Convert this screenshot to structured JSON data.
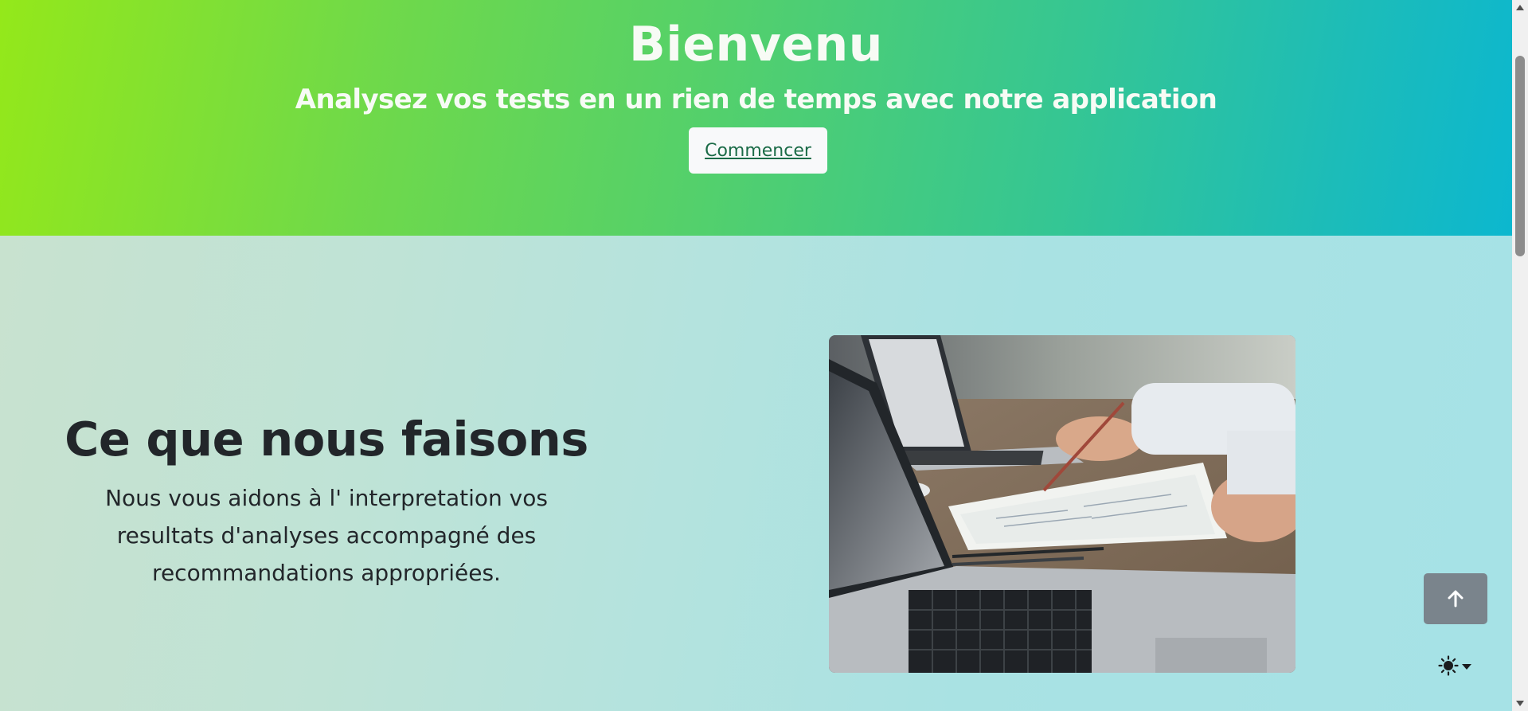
{
  "hero": {
    "title": "Bienvenu",
    "subtitle": "Analysez vos tests en un rien de temps avec notre application",
    "button_label": "Commencer"
  },
  "about": {
    "title": "Ce que nous faisons",
    "description": "Nous vous aidons à l' interpretation vos resultats d'analyses accompagné des recommandations appropriées."
  },
  "image": {
    "subject": "photo of laptops and hands analysing printed documents"
  },
  "controls": {
    "back_to_top_icon": "arrow-up-icon",
    "theme_icon": "sun-icon",
    "theme_caret_icon": "caret-down-icon"
  },
  "colors": {
    "hero_gradient_start": "#94e81a",
    "hero_gradient_end": "#0cb7cf",
    "section_gradient_start": "#c8e2cf",
    "section_gradient_end": "#a6e2e6",
    "button_bg": "#f8f9fa",
    "button_text": "#1b6b47",
    "back_top_bg": "#7a848c"
  }
}
